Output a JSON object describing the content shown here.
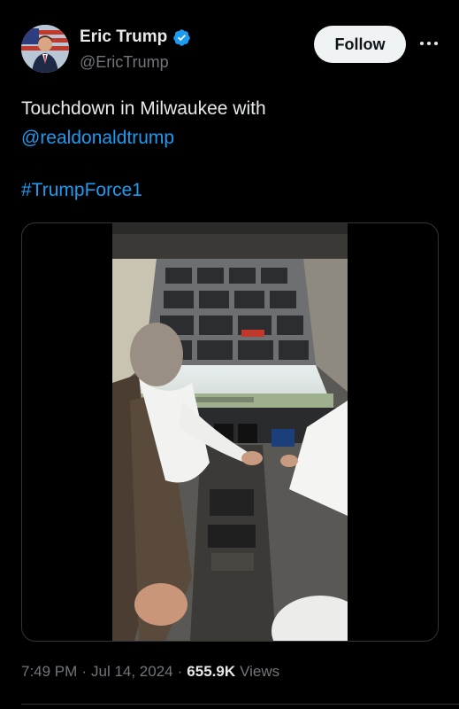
{
  "author": {
    "name": "Eric Trump",
    "handle": "@EricTrump",
    "avatar_icon": "profile-photo-flag-background"
  },
  "actions": {
    "follow_label": "Follow",
    "more_icon": "more-horizontal-icon"
  },
  "post": {
    "text_line1": "Touchdown in Milwaukee with",
    "mention": "@realdonaldtrump",
    "hashtag": "#TrumpForce1"
  },
  "media": {
    "type": "video",
    "icon": "cockpit-video-thumbnail"
  },
  "meta": {
    "time": "7:49 PM",
    "sep1": "·",
    "date": "Jul 14, 2024",
    "sep2": "·",
    "views_count": "655.9K",
    "views_label": "Views"
  },
  "colors": {
    "background": "#000000",
    "text": "#e7e9ea",
    "secondary": "#71767b",
    "link": "#1d9bf0",
    "verified": "#1d9bf0"
  }
}
